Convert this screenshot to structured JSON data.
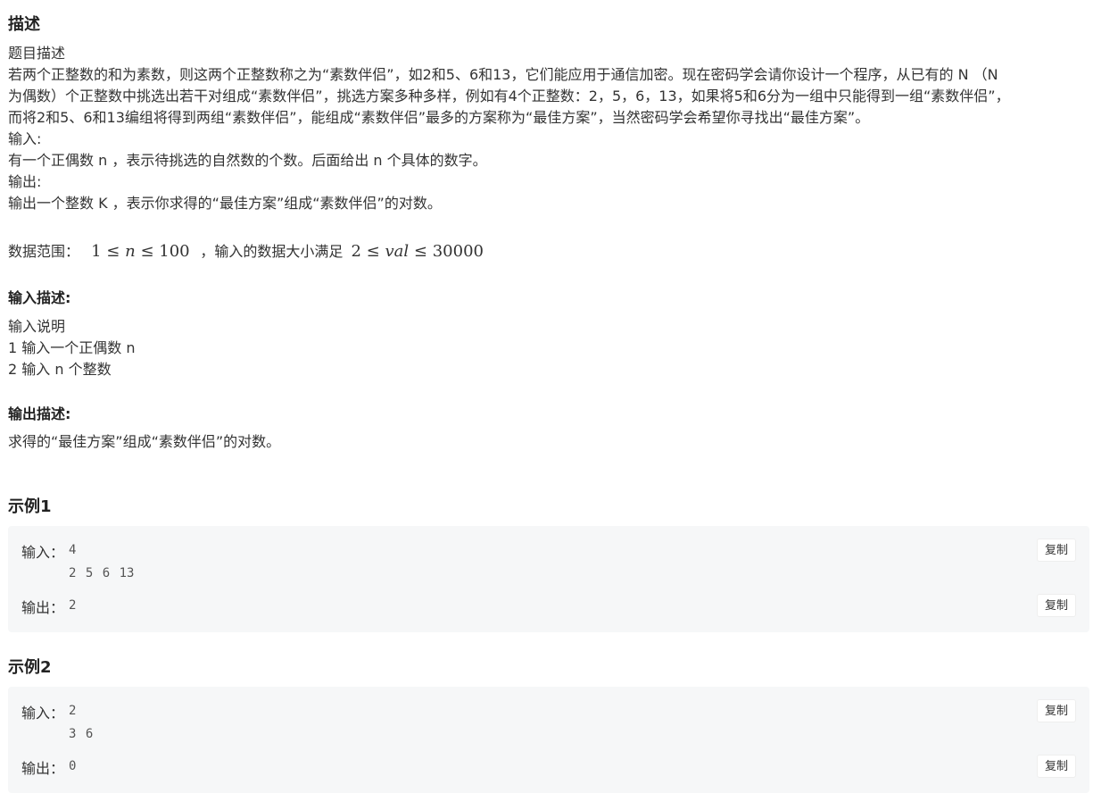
{
  "desc_title": "描述",
  "desc": {
    "line1": "题目描述",
    "line2": "若两个正整数的和为素数，则这两个正整数称之为“素数伴侣”，如2和5、6和13，它们能应用于通信加密。现在密码学会请你设计一个程序，从已有的 N （N",
    "line3": "为偶数）个正整数中挑选出若干对组成“素数伴侣”，挑选方案多种多样，例如有4个正整数：2，5，6，13，如果将5和6分为一组中只能得到一组“素数伴侣”，",
    "line4": "而将2和5、6和13编组将得到两组“素数伴侣”，能组成“素数伴侣”最多的方案称为“最佳方案”，当然密码学会希望你寻找出“最佳方案”。",
    "input_label": "输入:",
    "input_text": "有一个正偶数 n ，表示待挑选的自然数的个数。后面给出 n 个具体的数字。",
    "output_label": "输出:",
    "output_text": "输出一个整数 K ，表示你求得的“最佳方案”组成“素数伴侣”的对数。",
    "range_prefix": "数据范围：",
    "range_1": "1",
    "range_n": "n",
    "range_100": "100",
    "range_mid": "，输入的数据大小满足",
    "range_2": "2",
    "range_val": "val",
    "range_30000": "30000",
    "leq": "≤"
  },
  "input_desc": {
    "title": "输入描述:",
    "line1": "输入说明",
    "line2": "1 输入一个正偶数 n",
    "line3": "2 输入 n 个整数"
  },
  "output_desc": {
    "title": "输出描述:",
    "line1": "求得的“最佳方案”组成“素数伴侣”的对数。"
  },
  "examples": [
    {
      "title": "示例1",
      "input_label": "输入：",
      "input_line1": "4",
      "input_line2": "2 5 6 13",
      "output_label": "输出：",
      "output_value": "2",
      "copy_label": "复制"
    },
    {
      "title": "示例2",
      "input_label": "输入：",
      "input_line1": "2",
      "input_line2": "3 6",
      "output_label": "输出：",
      "output_value": "0",
      "copy_label": "复制"
    }
  ]
}
